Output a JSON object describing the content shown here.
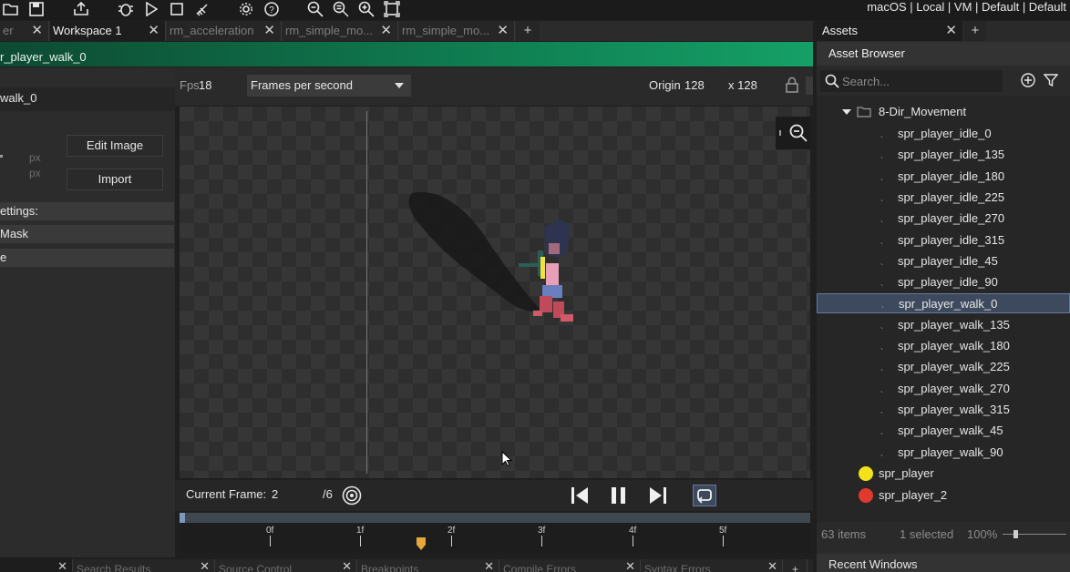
{
  "toolbar": {
    "icons": [
      "folder-open-icon",
      "save-icon",
      "export-icon",
      "debug-icon",
      "run-icon",
      "stop-icon",
      "clean-icon",
      "settings-icon",
      "help-icon",
      "zoom-out-icon",
      "zoom-reset-icon",
      "zoom-in-icon",
      "fit-icon"
    ],
    "target_text": "macOS | Local | VM | Default | Default"
  },
  "tabs": {
    "items": [
      {
        "label": "er",
        "active": false
      },
      {
        "label": "Workspace 1",
        "active": true
      },
      {
        "label": "rm_acceleration",
        "active": false
      },
      {
        "label": "rm_simple_mo...",
        "active": false
      },
      {
        "label": "rm_simple_mo...",
        "active": false
      }
    ],
    "close_glyph": "✕",
    "add_glyph": "+"
  },
  "editor": {
    "title": "r_player_walk_0",
    "sprite_name": "walk_0",
    "edit_image_label": "Edit Image",
    "import_label": "Import",
    "px_label": "px",
    "sections": [
      "ettings:",
      "Mask",
      "e"
    ],
    "fps_label": "Fps",
    "fps_value": "18",
    "fps_mode": "Frames per second",
    "origin_label": "Origin",
    "origin_x": "128",
    "origin_y": "x 128"
  },
  "playback": {
    "current_frame_label": "Current Frame:",
    "current_frame": "2",
    "total_frames": "/6"
  },
  "timeline": {
    "labels": [
      "0f",
      "1f",
      "2f",
      "3f",
      "4f",
      "5f"
    ],
    "playhead_frame": 1.67
  },
  "bottom_tabs": [
    "",
    "Search Results",
    "Source Control",
    "Breakpoints",
    "Compile Errors",
    "Syntax Errors"
  ],
  "assets": {
    "tab_label": "Assets",
    "panel_title": "Asset Browser",
    "search_placeholder": "Search...",
    "folder": "8-Dir_Movement",
    "items": [
      "spr_player_idle_0",
      "spr_player_idle_135",
      "spr_player_idle_180",
      "spr_player_idle_225",
      "spr_player_idle_270",
      "spr_player_idle_315",
      "spr_player_idle_45",
      "spr_player_idle_90",
      "spr_player_walk_0",
      "spr_player_walk_135",
      "spr_player_walk_180",
      "spr_player_walk_225",
      "spr_player_walk_270",
      "spr_player_walk_315",
      "spr_player_walk_45",
      "spr_player_walk_90"
    ],
    "selected_index": 8,
    "extra_items": [
      {
        "label": "spr_player",
        "color": "#f3e21a"
      },
      {
        "label": "spr_player_2",
        "color": "#e03a2f"
      }
    ],
    "item_count": "63 items",
    "selected_count": "1 selected",
    "zoom": "100%",
    "recent_windows": "Recent Windows"
  },
  "colors": {
    "accent_green": "#15a067",
    "selection": "#3d4a5e"
  }
}
